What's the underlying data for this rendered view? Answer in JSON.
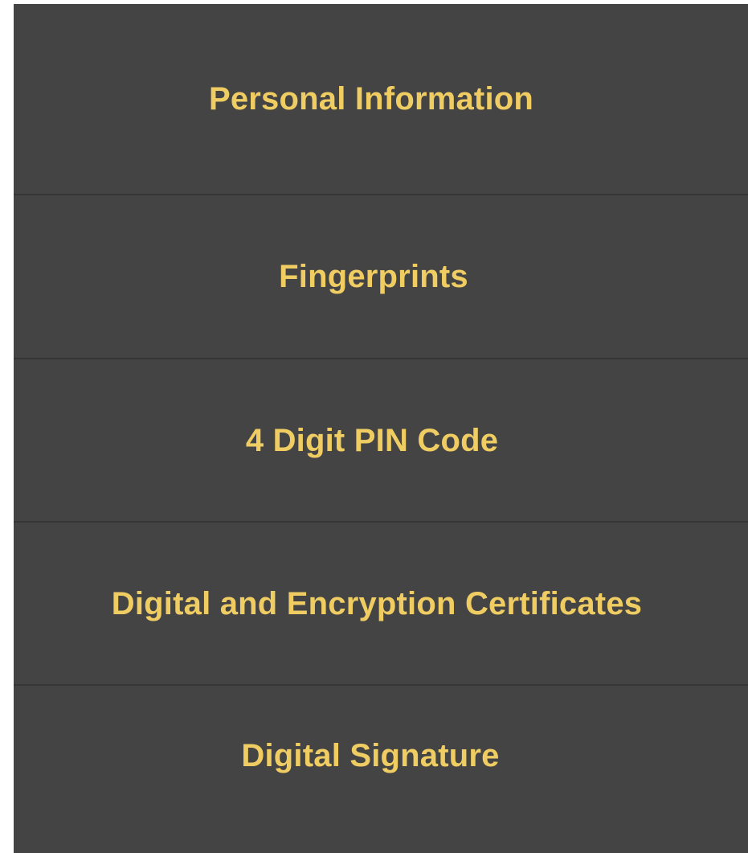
{
  "menu": {
    "items": [
      {
        "label": "Personal Information"
      },
      {
        "label": "Fingerprints"
      },
      {
        "label": "4 Digit PIN Code"
      },
      {
        "label": "Digital and Encryption Certificates"
      },
      {
        "label": "Digital Signature"
      }
    ]
  },
  "colors": {
    "background": "#444444",
    "text": "#f0cd62",
    "divider": "#363636"
  }
}
